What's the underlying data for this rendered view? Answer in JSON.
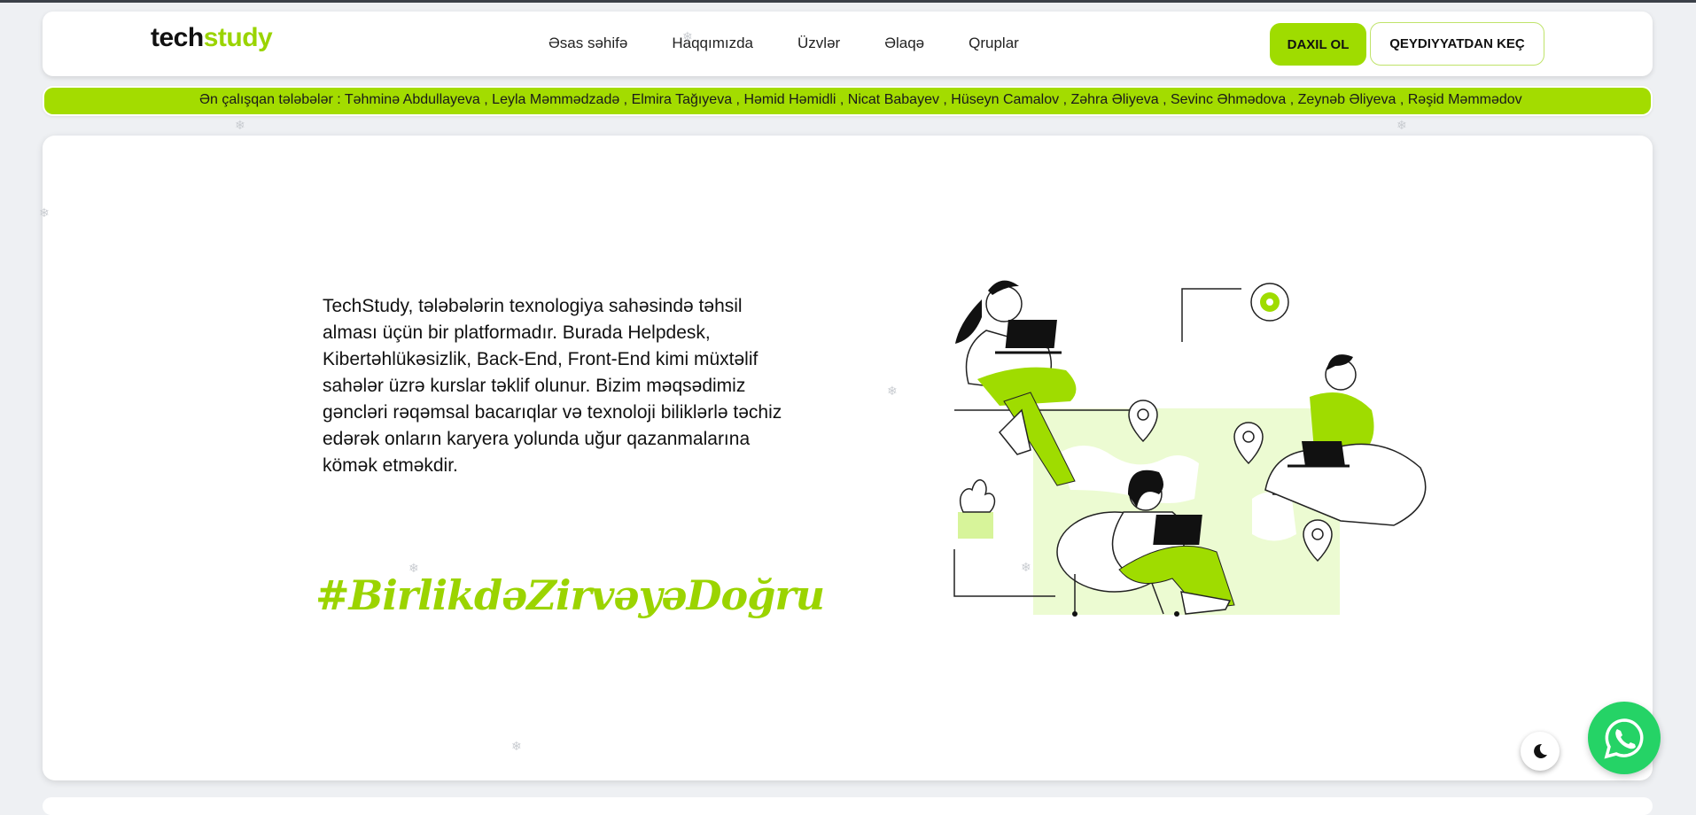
{
  "header": {
    "logo_part1": "tech",
    "logo_part2": "study",
    "nav": [
      "Əsas səhifə",
      "Haqqımızda",
      "Üzvlər",
      "Əlaqə",
      "Qruplar"
    ],
    "login_label": "DAXIL OL",
    "register_label": "QEYDIYYATDAN KEÇ"
  },
  "ticker": {
    "text": "Ən çalışqan tələbələr : Təhminə Abdullayeva , Leyla Məmmədzadə , Elmira Tağıyeva , Həmid Həmidli , Nicat Babayev , Hüseyn Camalov , Zəhra Əliyeva , Sevinc Əhmədova , Zeynəb Əliyeva , Rəşid Məmmədov"
  },
  "hero": {
    "description": "TechStudy, tələbələrin texnologiya sahəsində təhsil alması üçün bir platformadır. Burada Helpdesk, Kibertəhlükəsizlik, Back-End, Front-End kimi müxtəlif sahələr üzrə kurslar təklif olunur. Bizim məqsədimiz gəncləri rəqəmsal bacarıqlar və texnoloji biliklərlə təchiz edərək onların karyera yolunda uğur qazanmalarına kömək etməkdir.",
    "hashtag": "#BirlikdəZirvəyəDoğru"
  },
  "colors": {
    "accent": "#9fdc00",
    "whatsapp": "#25d366"
  },
  "icons": {
    "theme": "moon-icon",
    "chat": "whatsapp-icon"
  }
}
